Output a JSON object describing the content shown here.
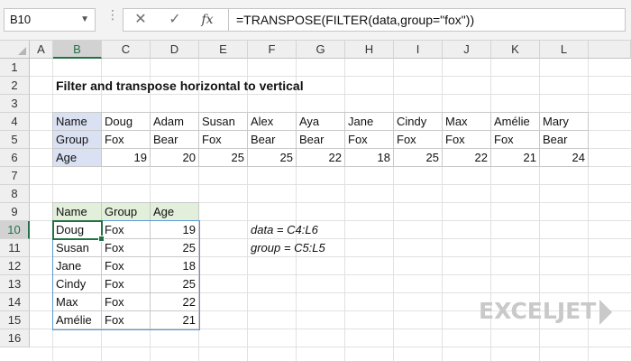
{
  "formula_bar": {
    "name_box": "B10",
    "cancel_icon": "x-icon",
    "enter_icon": "check-icon",
    "function_label": "fx",
    "formula": "=TRANSPOSE(FILTER(data,group=\"fox\"))"
  },
  "grid": {
    "columns": [
      "A",
      "B",
      "C",
      "D",
      "E",
      "F",
      "G",
      "H",
      "I",
      "J",
      "K",
      "L"
    ],
    "rows": [
      "1",
      "2",
      "3",
      "4",
      "5",
      "6",
      "7",
      "8",
      "9",
      "10",
      "11",
      "12",
      "13",
      "14",
      "15",
      "16"
    ],
    "selected_column": "B",
    "selected_row": "10"
  },
  "sheet": {
    "title": "Filter and transpose horizontal to vertical",
    "source": {
      "labels": [
        "Name",
        "Group",
        "Age"
      ],
      "names": [
        "Doug",
        "Adam",
        "Susan",
        "Alex",
        "Aya",
        "Jane",
        "Cindy",
        "Max",
        "Amélie",
        "Mary"
      ],
      "groups": [
        "Fox",
        "Bear",
        "Fox",
        "Bear",
        "Bear",
        "Fox",
        "Fox",
        "Fox",
        "Fox",
        "Bear"
      ],
      "ages": [
        "19",
        "20",
        "25",
        "25",
        "22",
        "18",
        "25",
        "22",
        "21",
        "24"
      ]
    },
    "result": {
      "headers": [
        "Name",
        "Group",
        "Age"
      ],
      "rows": [
        [
          "Doug",
          "Fox",
          "19"
        ],
        [
          "Susan",
          "Fox",
          "25"
        ],
        [
          "Jane",
          "Fox",
          "18"
        ],
        [
          "Cindy",
          "Fox",
          "25"
        ],
        [
          "Max",
          "Fox",
          "22"
        ],
        [
          "Amélie",
          "Fox",
          "21"
        ]
      ]
    },
    "notes": [
      "data = C4:L6",
      "group = C5:L5"
    ]
  },
  "logo": {
    "text": "EXCELJET"
  }
}
